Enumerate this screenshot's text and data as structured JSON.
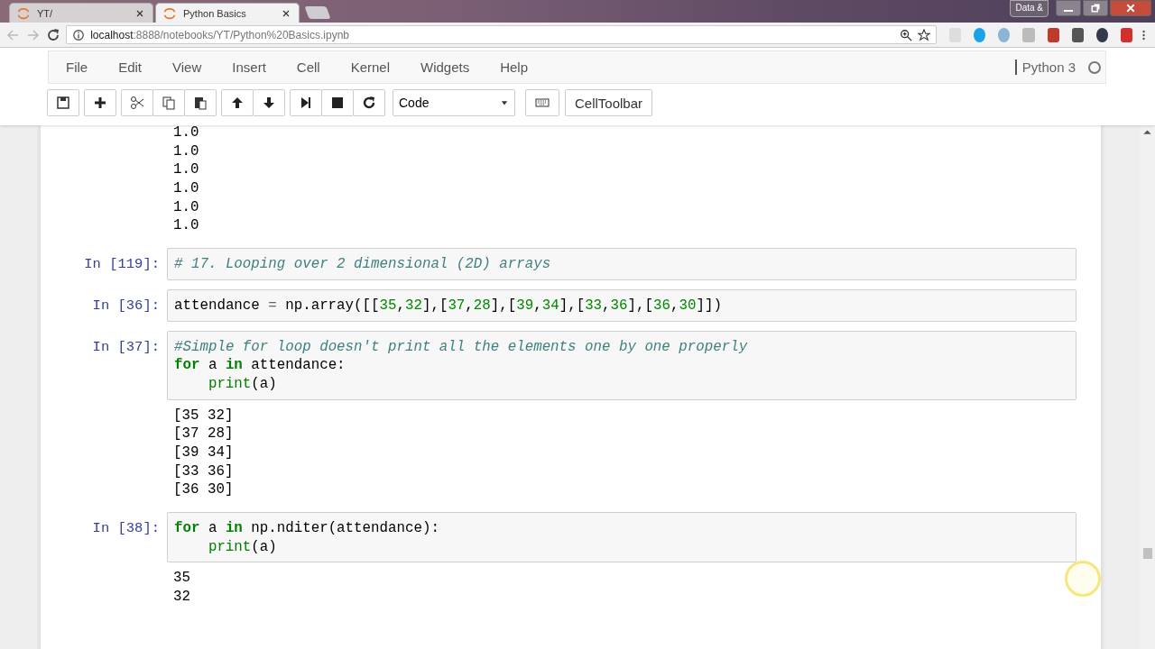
{
  "browser": {
    "tabs": [
      {
        "title": "YT/",
        "selected": false
      },
      {
        "title": "Python Basics",
        "selected": true
      }
    ],
    "profile_button": "Data &",
    "url_host": "localhost",
    "url_path": ":8888/notebooks/YT/Python%20Basics.ipynb"
  },
  "menu": [
    "File",
    "Edit",
    "View",
    "Insert",
    "Cell",
    "Kernel",
    "Widgets",
    "Help"
  ],
  "kernel": {
    "name": "Python 3",
    "busy": false
  },
  "toolbar": {
    "cell_type": "Code",
    "cell_toolbar": "CellToolbar"
  },
  "cells": [
    {
      "kind": "output",
      "output": [
        "1.0",
        "1.0",
        "1.0",
        "1.0",
        "1.0",
        "1.0"
      ]
    },
    {
      "kind": "code",
      "prompt": "In [119]:",
      "lines": [
        {
          "indented": false,
          "tokens": [
            {
              "kind": "comment",
              "s": "# 17. Looping over 2 dimensional (2D) arrays"
            }
          ]
        }
      ]
    },
    {
      "kind": "code",
      "prompt": "In [36]:",
      "lines": [
        {
          "indented": false,
          "tokens": [
            {
              "kind": "plain",
              "s": "attendance"
            },
            {
              "kind": "op",
              "s": "="
            },
            {
              "kind": "plain",
              "s": "np.array([["
            },
            {
              "kind": "num",
              "s": "35"
            },
            {
              "kind": "plain",
              "s": ","
            },
            {
              "kind": "num",
              "s": "32"
            },
            {
              "kind": "plain",
              "s": "],["
            },
            {
              "kind": "num",
              "s": "37"
            },
            {
              "kind": "plain",
              "s": ","
            },
            {
              "kind": "num",
              "s": "28"
            },
            {
              "kind": "plain",
              "s": "],["
            },
            {
              "kind": "num",
              "s": "39"
            },
            {
              "kind": "plain",
              "s": ","
            },
            {
              "kind": "num",
              "s": "34"
            },
            {
              "kind": "plain",
              "s": "],["
            },
            {
              "kind": "num",
              "s": "33"
            },
            {
              "kind": "plain",
              "s": ","
            },
            {
              "kind": "num",
              "s": "36"
            },
            {
              "kind": "plain",
              "s": "],["
            },
            {
              "kind": "num",
              "s": "36"
            },
            {
              "kind": "plain",
              "s": ","
            },
            {
              "kind": "num",
              "s": "30"
            },
            {
              "kind": "plain",
              "s": "]])"
            }
          ]
        }
      ]
    },
    {
      "kind": "code",
      "prompt": "In [37]:",
      "lines": [
        {
          "indented": false,
          "tokens": [
            {
              "kind": "comment",
              "s": "#Simple for loop doesn't print all the elements one by one properly"
            }
          ]
        },
        {
          "indented": false,
          "tokens": [
            {
              "kind": "kw",
              "s": "for"
            },
            {
              "kind": "plain",
              "s": "a"
            },
            {
              "kind": "kw",
              "s": "in"
            },
            {
              "kind": "plain",
              "s": "attendance:"
            }
          ]
        },
        {
          "indented": true,
          "tokens": [
            {
              "kind": "builtin",
              "s": "print"
            },
            {
              "kind": "plain",
              "s": "(a)"
            }
          ]
        }
      ],
      "output": [
        "[35 32]",
        "[37 28]",
        "[39 34]",
        "[33 36]",
        "[36 30]"
      ]
    },
    {
      "kind": "code",
      "prompt": "In [38]:",
      "lines": [
        {
          "indented": false,
          "tokens": [
            {
              "kind": "kw",
              "s": "for"
            },
            {
              "kind": "plain",
              "s": "a"
            },
            {
              "kind": "kw",
              "s": "in"
            },
            {
              "kind": "plain",
              "s": "np.nditer(attendance):"
            }
          ]
        },
        {
          "indented": true,
          "tokens": [
            {
              "kind": "builtin",
              "s": "print"
            },
            {
              "kind": "plain",
              "s": "(a)"
            }
          ]
        }
      ],
      "output": [
        "35",
        "32"
      ]
    }
  ]
}
